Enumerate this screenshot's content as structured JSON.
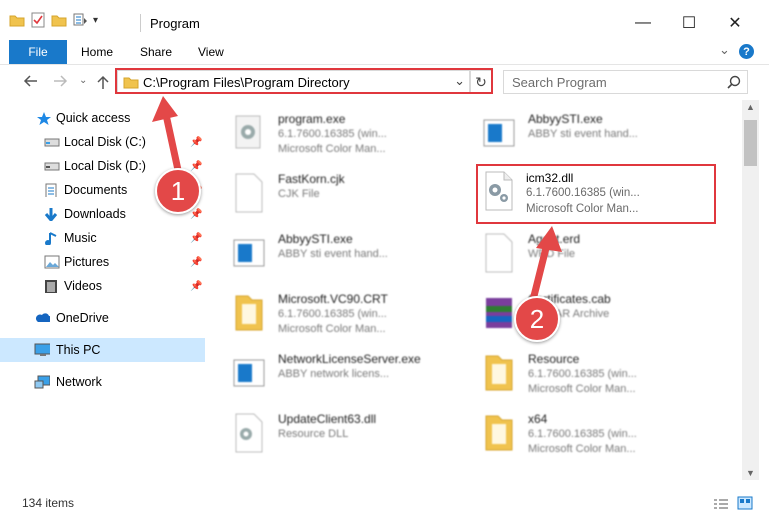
{
  "window": {
    "title": "Program",
    "controls": {
      "minimize": "—",
      "maximize": "☐",
      "close": "✕"
    }
  },
  "ribbon": {
    "tabs": [
      "File",
      "Home",
      "Share",
      "View"
    ],
    "help": "?",
    "collapse": "⌄"
  },
  "address": {
    "path": "C:\\Program Files\\Program Directory",
    "dropdown": "⌄",
    "refresh": "↻"
  },
  "search": {
    "placeholder": "Search Program"
  },
  "sidebar": {
    "items": [
      {
        "label": "Quick access",
        "icon": "star-icon",
        "pinned": false
      },
      {
        "label": "Local Disk (C:)",
        "icon": "drive-icon",
        "pinned": true
      },
      {
        "label": "Local Disk (D:)",
        "icon": "drive-icon",
        "pinned": true
      },
      {
        "label": "Documents",
        "icon": "documents-icon",
        "pinned": true
      },
      {
        "label": "Downloads",
        "icon": "download-icon",
        "pinned": true
      },
      {
        "label": "Music",
        "icon": "music-icon",
        "pinned": true
      },
      {
        "label": "Pictures",
        "icon": "pictures-icon",
        "pinned": true
      },
      {
        "label": "Videos",
        "icon": "videos-icon",
        "pinned": true
      },
      {
        "label": "OneDrive",
        "icon": "cloud-icon",
        "pinned": false
      },
      {
        "label": "This PC",
        "icon": "computer-icon",
        "pinned": false,
        "selected": true
      },
      {
        "label": "Network",
        "icon": "network-icon",
        "pinned": false
      }
    ]
  },
  "files": [
    {
      "name": "program.exe",
      "line1": "6.1.7600.16385 (win...",
      "line2": "Microsoft Color Man...",
      "icon": "gear-exe-icon"
    },
    {
      "name": "AbbyySTI.exe",
      "line1": "ABBY sti event hand...",
      "line2": "",
      "icon": "app-window-icon"
    },
    {
      "name": "FastKorn.cjk",
      "line1": "CJK File",
      "line2": "",
      "icon": "blank-file-icon"
    },
    {
      "name": "icm32.dll",
      "line1": "6.1.7600.16385 (win...",
      "line2": "Microsoft Color Man...",
      "icon": "dll-gear-icon"
    },
    {
      "name": "AbbyySTI.exe",
      "line1": "ABBY sti event hand...",
      "line2": "",
      "icon": "app-window-icon"
    },
    {
      "name": "Agent.erd",
      "line1": "WRD File",
      "line2": "",
      "icon": "blank-file-icon"
    },
    {
      "name": "Microsoft.VC90.CRT",
      "line1": "6.1.7600.16385 (win...",
      "line2": "Microsoft Color Man...",
      "icon": "folder-icon"
    },
    {
      "name": "Certificates.cab",
      "line1": "WinRAR Archive",
      "line2": "",
      "icon": "archive-icon"
    },
    {
      "name": "NetworkLicenseServer.exe",
      "line1": "ABBY network licens...",
      "line2": "",
      "icon": "app-window-icon"
    },
    {
      "name": "Resource",
      "line1": "6.1.7600.16385 (win...",
      "line2": "Microsoft Color Man...",
      "icon": "folder-icon"
    },
    {
      "name": "UpdateClient63.dll",
      "line1": "Resource DLL",
      "line2": "",
      "icon": "dll-gear-icon"
    },
    {
      "name": "x64",
      "line1": "6.1.7600.16385 (win...",
      "line2": "Microsoft Color Man...",
      "icon": "folder-icon"
    }
  ],
  "status": {
    "items": "134 items"
  },
  "annotations": [
    {
      "number": "1"
    },
    {
      "number": "2"
    }
  ],
  "colors": {
    "accent": "#1979ca",
    "highlight": "#e0373d",
    "selected": "#cce8ff"
  }
}
